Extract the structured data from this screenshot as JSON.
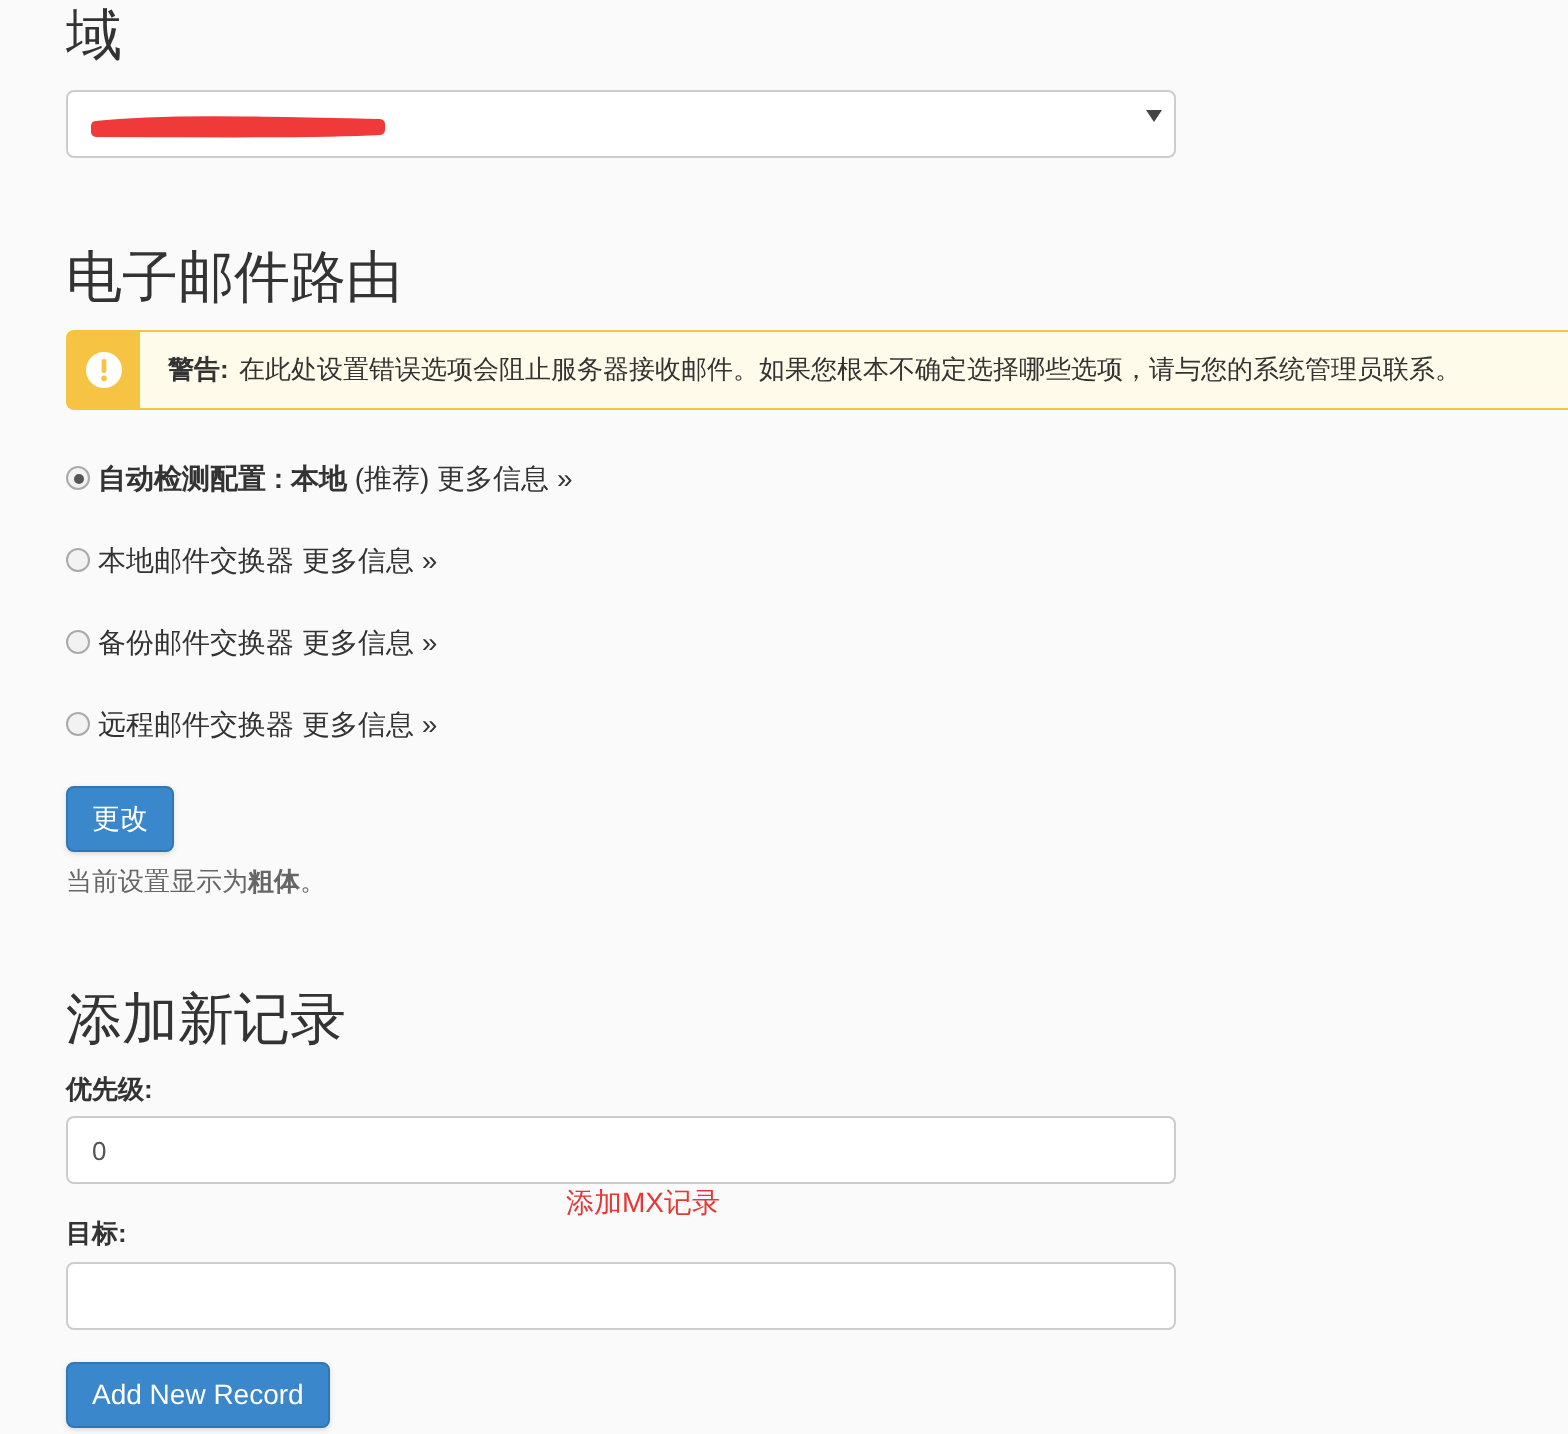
{
  "domain": {
    "heading": "域",
    "redacted": true
  },
  "routing": {
    "heading": "电子邮件路由",
    "warning_label": "警告:",
    "warning": "在此处设置错误选项会阻止服务器接收邮件。如果您根本不确定选择哪些选项，请与您的系统管理员联系。",
    "options": [
      {
        "label": "**自动检测配置 : 本地** (推荐)",
        "link": "更多信息 »",
        "selected": true
      },
      {
        "label": "本地邮件交换器",
        "link": "更多信息 »",
        "selected": false
      },
      {
        "label": "备份邮件交换器",
        "link": "更多信息 »",
        "selected": false
      },
      {
        "label": "远程邮件交换器",
        "link": "更多信息 »",
        "selected": false
      }
    ],
    "button": "更改",
    "note": "当前设置显示为**粗体**。"
  },
  "add_record": {
    "heading": "添加新记录",
    "priority_label": "优先级:",
    "priority_value": "0",
    "annotation": "添加MX记录",
    "target_label": "目标:",
    "button": "Add New Record"
  }
}
